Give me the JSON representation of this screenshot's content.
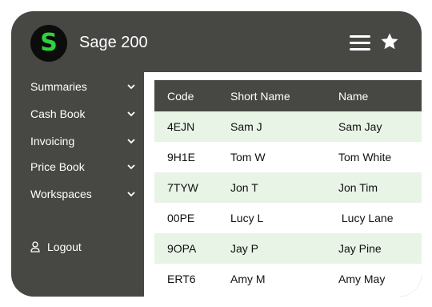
{
  "app": {
    "title": "Sage 200",
    "logo_glyph": "S",
    "logo_color": "#2fd13c"
  },
  "header": {
    "menu_icon": "hamburger-menu-icon",
    "favorite_icon": "star-icon"
  },
  "sidebar": {
    "items": [
      {
        "label": "Summaries"
      },
      {
        "label": "Cash Book"
      },
      {
        "label": "Invoicing"
      },
      {
        "label": "Price Book"
      },
      {
        "label": "Workspaces"
      }
    ],
    "logout_label": "Logout"
  },
  "table": {
    "columns": [
      "Code",
      "Short Name",
      "Name"
    ],
    "rows": [
      [
        "4EJN",
        "Sam J",
        "Sam Jay"
      ],
      [
        "9H1E",
        "Tom W",
        "Tom White"
      ],
      [
        "7TYW",
        "Jon T",
        "Jon Tim"
      ],
      [
        "00PE",
        "Lucy L",
        " Lucy Lane"
      ],
      [
        "9OPA",
        "Jay P",
        "Jay Pine"
      ],
      [
        "ERT6",
        "Amy M",
        "Amy May"
      ]
    ]
  },
  "colors": {
    "panel": "#474744",
    "row_highlight": "#e8f4e6",
    "accent": "#2fd13c"
  }
}
